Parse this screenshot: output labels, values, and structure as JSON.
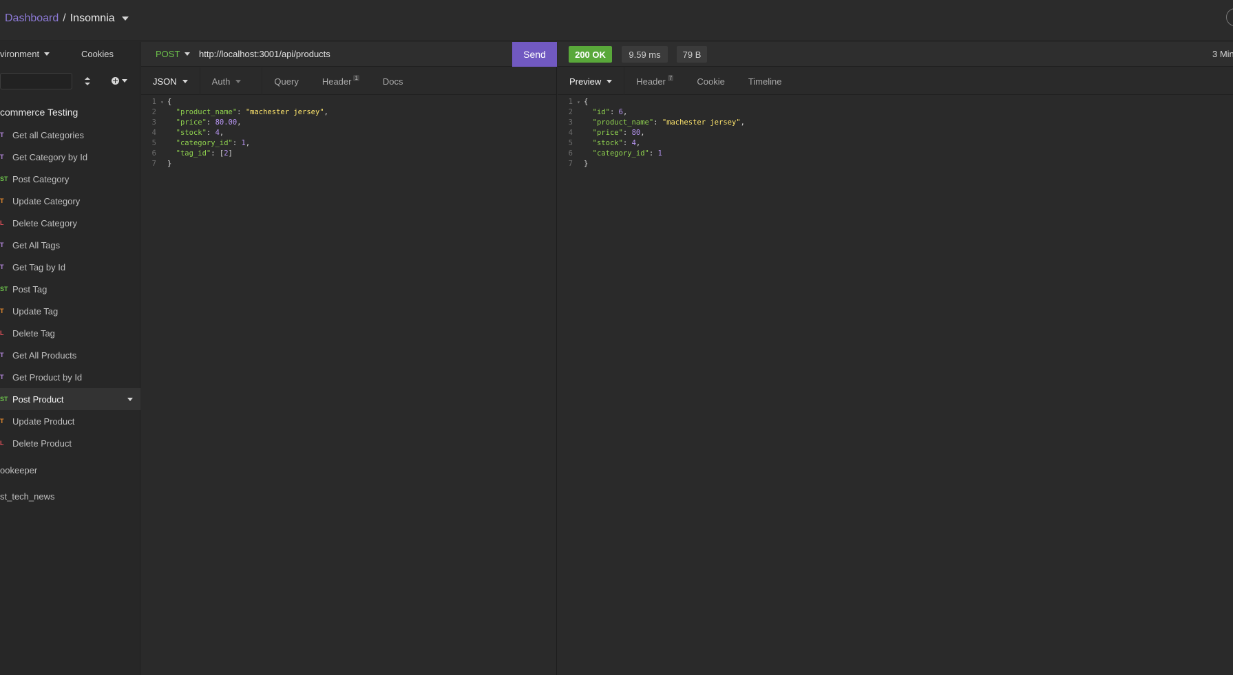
{
  "header": {
    "dashboard_link": "Dashboard",
    "separator": "/",
    "workspace_name": "Insomnia"
  },
  "sidebar": {
    "environment_label": "vironment",
    "cookies_label": "Cookies",
    "filter_placeholder": "",
    "folder_name": "commerce Testing",
    "requests": [
      {
        "method": "GET",
        "method_visible": "T",
        "method_class": "m-get",
        "name": "Get all Categories"
      },
      {
        "method": "GET",
        "method_visible": "T",
        "method_class": "m-get",
        "name": "Get Category by Id"
      },
      {
        "method": "POST",
        "method_visible": "ST",
        "method_class": "m-post",
        "name": "Post Category"
      },
      {
        "method": "PUT",
        "method_visible": "T",
        "method_class": "m-put",
        "name": "Update Category"
      },
      {
        "method": "DELETE",
        "method_visible": "L",
        "method_class": "m-del",
        "name": "Delete Category"
      },
      {
        "method": "GET",
        "method_visible": "T",
        "method_class": "m-get",
        "name": "Get All Tags"
      },
      {
        "method": "GET",
        "method_visible": "T",
        "method_class": "m-get",
        "name": "Get Tag by Id"
      },
      {
        "method": "POST",
        "method_visible": "ST",
        "method_class": "m-post",
        "name": "Post Tag"
      },
      {
        "method": "PUT",
        "method_visible": "T",
        "method_class": "m-put",
        "name": "Update Tag"
      },
      {
        "method": "DELETE",
        "method_visible": "L",
        "method_class": "m-del",
        "name": "Delete Tag"
      },
      {
        "method": "GET",
        "method_visible": "T",
        "method_class": "m-get",
        "name": "Get All Products"
      },
      {
        "method": "GET",
        "method_visible": "T",
        "method_class": "m-get",
        "name": "Get Product by Id"
      },
      {
        "method": "POST",
        "method_visible": "ST",
        "method_class": "m-post",
        "name": "Post Product",
        "active": true
      },
      {
        "method": "PUT",
        "method_visible": "T",
        "method_class": "m-put",
        "name": "Update Product"
      },
      {
        "method": "DELETE",
        "method_visible": "L",
        "method_class": "m-del",
        "name": "Delete Product"
      }
    ],
    "other_folders": [
      "ookeeper",
      "st_tech_news"
    ]
  },
  "request": {
    "method": "POST",
    "url": "http://localhost:3001/api/products",
    "send_label": "Send",
    "tabs": {
      "body": "JSON",
      "auth": "Auth",
      "query": "Query",
      "header": "Header",
      "header_count": "1",
      "docs": "Docs"
    },
    "body_lines": [
      [
        {
          "t": "{",
          "c": "p"
        }
      ],
      [
        {
          "t": "  ",
          "c": "p"
        },
        {
          "t": "\"product_name\"",
          "c": "k"
        },
        {
          "t": ": ",
          "c": "p"
        },
        {
          "t": "\"machester jersey\"",
          "c": "s"
        },
        {
          "t": ",",
          "c": "p"
        }
      ],
      [
        {
          "t": "  ",
          "c": "p"
        },
        {
          "t": "\"price\"",
          "c": "k"
        },
        {
          "t": ": ",
          "c": "p"
        },
        {
          "t": "80.00",
          "c": "nm"
        },
        {
          "t": ",",
          "c": "p"
        }
      ],
      [
        {
          "t": "  ",
          "c": "p"
        },
        {
          "t": "\"stock\"",
          "c": "k"
        },
        {
          "t": ": ",
          "c": "p"
        },
        {
          "t": "4",
          "c": "nm"
        },
        {
          "t": ",",
          "c": "p"
        }
      ],
      [
        {
          "t": "  ",
          "c": "p"
        },
        {
          "t": "\"category_id\"",
          "c": "k"
        },
        {
          "t": ": ",
          "c": "p"
        },
        {
          "t": "1",
          "c": "nm"
        },
        {
          "t": ",",
          "c": "p"
        }
      ],
      [
        {
          "t": "  ",
          "c": "p"
        },
        {
          "t": "\"tag_id\"",
          "c": "k"
        },
        {
          "t": ": ",
          "c": "p"
        },
        {
          "t": "[",
          "c": "p"
        },
        {
          "t": "2",
          "c": "nm"
        },
        {
          "t": "]",
          "c": "p"
        }
      ],
      [
        {
          "t": "}",
          "c": "p"
        }
      ]
    ]
  },
  "response": {
    "status": "200 OK",
    "time": "9.59 ms",
    "size": "79 B",
    "ago": "3 Min",
    "tabs": {
      "preview": "Preview",
      "header": "Header",
      "header_count": "7",
      "cookie": "Cookie",
      "timeline": "Timeline"
    },
    "body_lines": [
      [
        {
          "t": "{",
          "c": "p"
        }
      ],
      [
        {
          "t": "  ",
          "c": "p"
        },
        {
          "t": "\"id\"",
          "c": "k"
        },
        {
          "t": ": ",
          "c": "p"
        },
        {
          "t": "6",
          "c": "nm"
        },
        {
          "t": ",",
          "c": "p"
        }
      ],
      [
        {
          "t": "  ",
          "c": "p"
        },
        {
          "t": "\"product_name\"",
          "c": "k"
        },
        {
          "t": ": ",
          "c": "p"
        },
        {
          "t": "\"machester jersey\"",
          "c": "s"
        },
        {
          "t": ",",
          "c": "p"
        }
      ],
      [
        {
          "t": "  ",
          "c": "p"
        },
        {
          "t": "\"price\"",
          "c": "k"
        },
        {
          "t": ": ",
          "c": "p"
        },
        {
          "t": "80",
          "c": "nm"
        },
        {
          "t": ",",
          "c": "p"
        }
      ],
      [
        {
          "t": "  ",
          "c": "p"
        },
        {
          "t": "\"stock\"",
          "c": "k"
        },
        {
          "t": ": ",
          "c": "p"
        },
        {
          "t": "4",
          "c": "nm"
        },
        {
          "t": ",",
          "c": "p"
        }
      ],
      [
        {
          "t": "  ",
          "c": "p"
        },
        {
          "t": "\"category_id\"",
          "c": "k"
        },
        {
          "t": ": ",
          "c": "p"
        },
        {
          "t": "1",
          "c": "nm"
        }
      ],
      [
        {
          "t": "}",
          "c": "p"
        }
      ]
    ]
  },
  "colors": {
    "accent": "#7159c1",
    "status_ok": "#59a83a",
    "method_post": "#6cc14b",
    "method_get": "#b185d8",
    "method_put": "#e68a2e",
    "method_delete": "#e5515b"
  }
}
